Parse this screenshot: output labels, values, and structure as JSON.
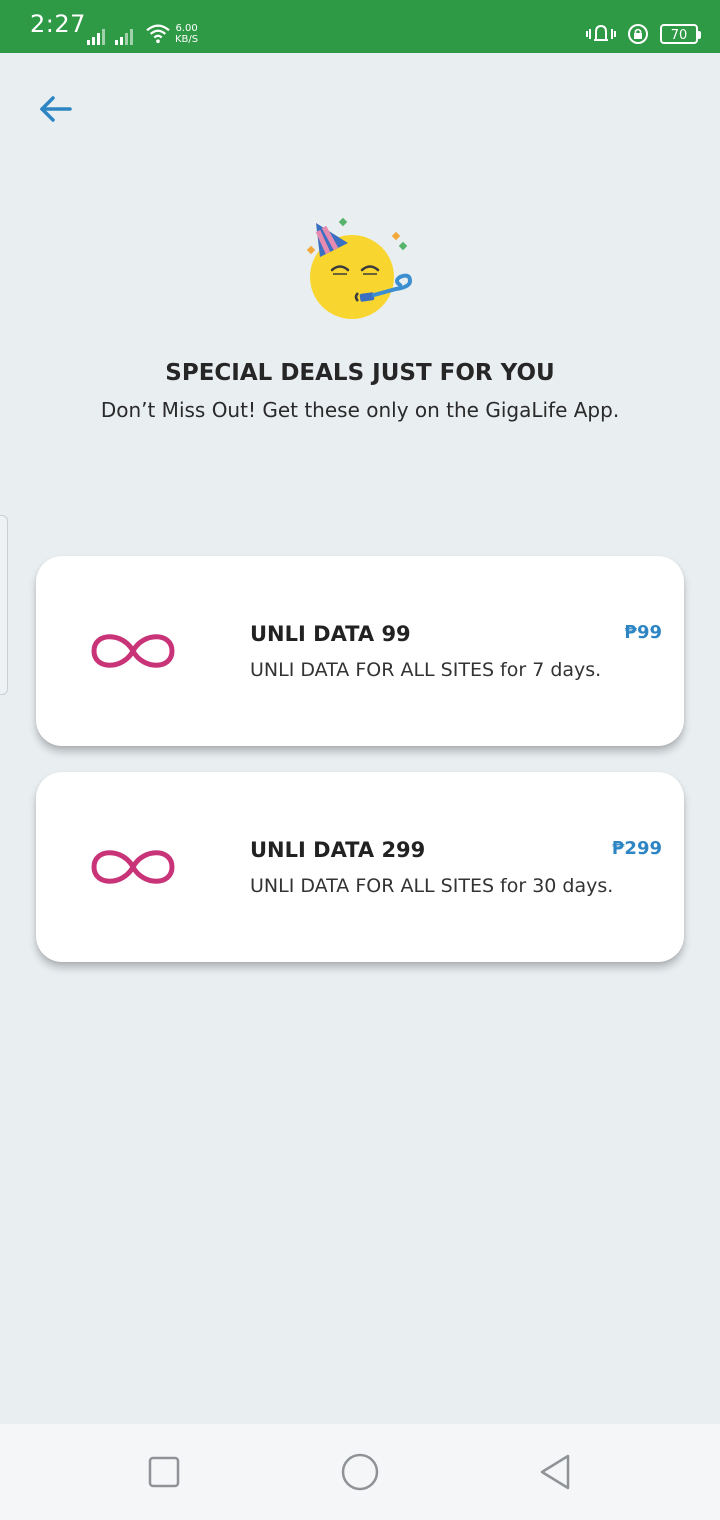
{
  "status_bar": {
    "time": "2:27",
    "net_speed_value": "6.00",
    "net_speed_unit": "KB/S",
    "battery": "70"
  },
  "header": {
    "back_icon": "arrow-left-icon"
  },
  "hero": {
    "icon": "party-face-icon",
    "title": "SPECIAL DEALS JUST FOR YOU",
    "subtitle": "Don’t Miss Out! Get these only on the GigaLife App."
  },
  "offers": [
    {
      "icon": "infinity-icon",
      "name": "UNLI DATA 99",
      "description": "UNLI DATA FOR ALL SITES for 7 days.",
      "price": "₱99"
    },
    {
      "icon": "infinity-icon",
      "name": "UNLI DATA 299",
      "description": "UNLI DATA FOR ALL SITES for 30 days.",
      "price": "₱299"
    }
  ],
  "nav_bar": {
    "recents_icon": "square-icon",
    "home_icon": "circle-icon",
    "back_icon": "triangle-back-icon"
  },
  "colors": {
    "status_bar": "#2f9a46",
    "background": "#e9eef1",
    "price": "#2d86c3",
    "infinity": "#c93479",
    "back_arrow": "#2d86c3"
  }
}
